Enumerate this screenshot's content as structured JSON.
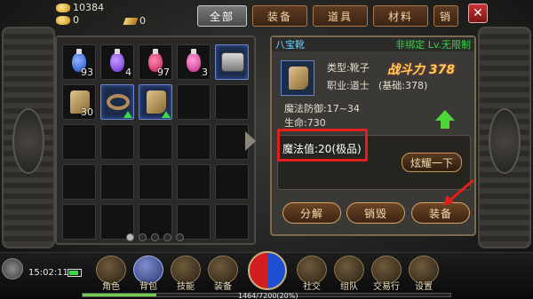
{
  "currency": {
    "gold": "10384",
    "ingot": "0",
    "coupon": "0"
  },
  "tabs": [
    "全部",
    "装备",
    "道具",
    "材料",
    "销"
  ],
  "active_tab": 0,
  "bag": {
    "slots": [
      {
        "type": "potion",
        "color": "blue",
        "count": "93"
      },
      {
        "type": "potion",
        "color": "purple",
        "count": "4"
      },
      {
        "type": "potion",
        "color": "red",
        "count": "97"
      },
      {
        "type": "potion",
        "color": "pink",
        "count": "3"
      },
      {
        "type": "chest",
        "count": ""
      },
      {
        "type": "boot-gold",
        "count": "30"
      },
      {
        "type": "belt",
        "count": "",
        "upgrade": true
      },
      {
        "type": "boot",
        "count": "",
        "upgrade": true
      }
    ],
    "page_count": 5,
    "current_page": 0
  },
  "detail": {
    "name": "八宝靴",
    "bind": "非绑定",
    "level": "Lv.无限制",
    "type_line": "类型:靴子",
    "job_line": "职业:道士",
    "power_label": "战斗力",
    "power_value": "378",
    "base_line": "(基础:378)",
    "magic_def": "魔法防御:17~34",
    "hp": "生命:730",
    "magic_value": "魔法值:20(极品)",
    "dazzle_button": "炫耀一下"
  },
  "actions": {
    "decompose": "分解",
    "destroy": "销毁",
    "equip": "装备"
  },
  "bottom": {
    "time": "15:02:11",
    "menu": [
      "角色",
      "背包",
      "技能",
      "装备",
      "社交",
      "组队",
      "交易行",
      "设置"
    ],
    "active_menu": 1,
    "exp_text": "1464/7200(20%)",
    "exp_fraction": 0.2
  }
}
